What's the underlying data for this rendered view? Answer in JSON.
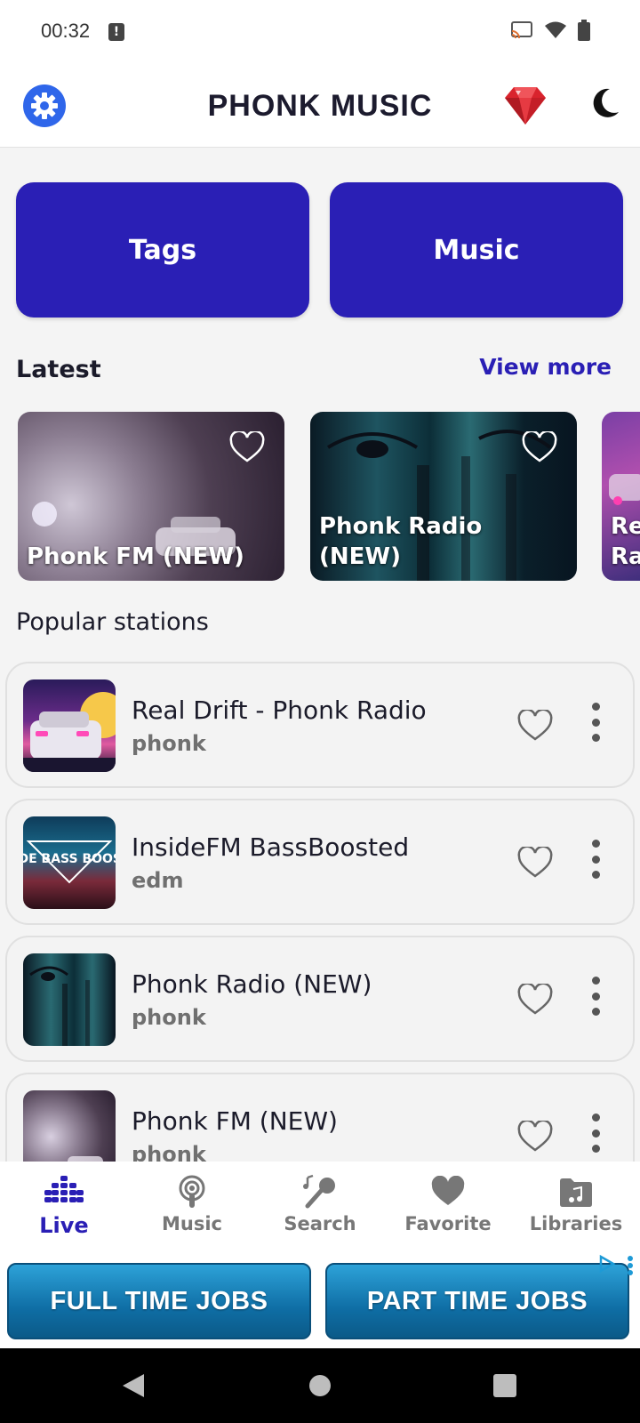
{
  "status_bar": {
    "time": "00:32"
  },
  "header": {
    "title": "PHONK MUSIC"
  },
  "top_buttons": {
    "tags": "Tags",
    "music": "Music"
  },
  "latest": {
    "title": "Latest",
    "view_more": "View more",
    "cards": [
      {
        "label": "Phonk FM (NEW)"
      },
      {
        "label": "Phonk Radio (NEW)"
      },
      {
        "label": "Re Ra"
      }
    ]
  },
  "popular": {
    "title": "Popular stations",
    "stations": [
      {
        "name": "Real Drift - Phonk Radio",
        "tag": "phonk",
        "thumb_text": ""
      },
      {
        "name": "InsideFM BassBoosted",
        "tag": "edm",
        "thumb_text": "INSIDE BASS BOOSTED"
      },
      {
        "name": "Phonk Radio (NEW)",
        "tag": "phonk",
        "thumb_text": ""
      },
      {
        "name": "Phonk FM (NEW)",
        "tag": "phonk",
        "thumb_text": ""
      }
    ]
  },
  "bottom_nav": {
    "items": [
      {
        "label": "Live",
        "icon": "equalizer-icon",
        "active": true
      },
      {
        "label": "Music",
        "icon": "podcast-icon",
        "active": false
      },
      {
        "label": "Search",
        "icon": "microphone-music-icon",
        "active": false
      },
      {
        "label": "Favorite",
        "icon": "heart-icon",
        "active": false
      },
      {
        "label": "Libraries",
        "icon": "music-folder-icon",
        "active": false
      }
    ]
  },
  "ad": {
    "left": "FULL TIME JOBS",
    "right": "PART TIME JOBS"
  },
  "colors": {
    "accent": "#2a1fb5",
    "settings_blue": "#2f66ea",
    "ad_blue": "#0f6ea5"
  }
}
